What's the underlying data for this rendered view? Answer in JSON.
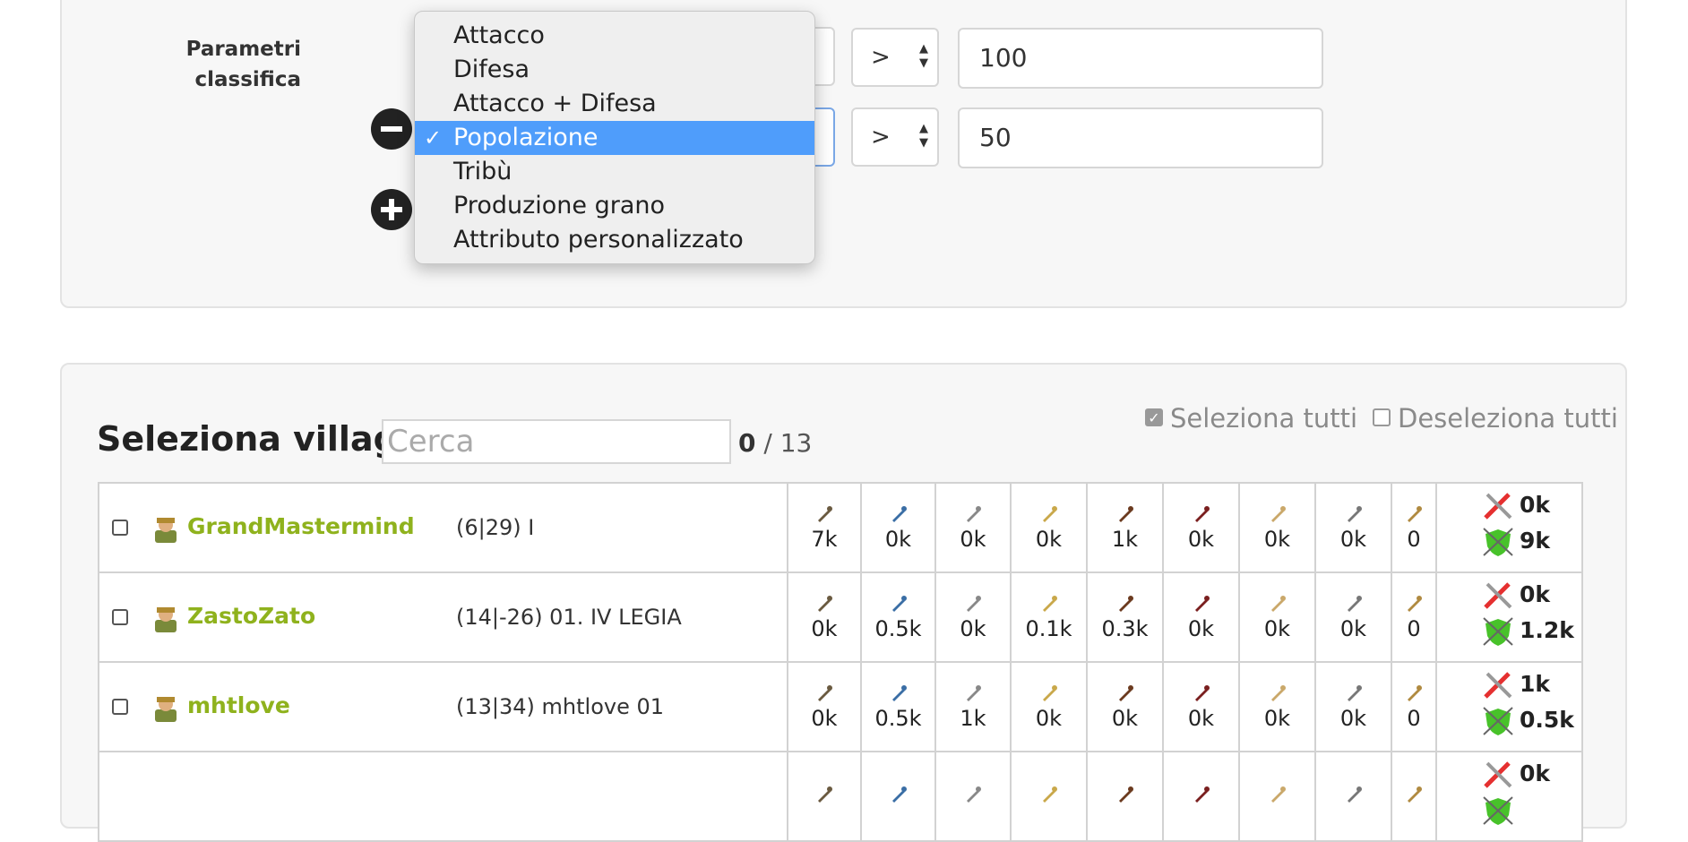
{
  "params": {
    "label_line1": "Parametri",
    "label_line2": "classifica",
    "rows": [
      {
        "operator": ">",
        "value": "100"
      },
      {
        "operator": ">",
        "value": "50"
      }
    ]
  },
  "dropdown": {
    "options": [
      "Attacco",
      "Difesa",
      "Attacco + Difesa",
      "Popolazione",
      "Tribù",
      "Produzione grano",
      "Attributo personalizzato"
    ],
    "selected": "Popolazione",
    "check_mark": "✓"
  },
  "villages": {
    "title": "Seleziona villaggi",
    "search_placeholder": "Cerca",
    "selected_count": "0",
    "total_label": "/ 13",
    "select_all_label": "Seleziona tutti",
    "deselect_all_label": "Deseleziona tutti",
    "rows": [
      {
        "player": "GrandMastermind",
        "village": "(6|29) I",
        "units": [
          "7k",
          "0k",
          "0k",
          "0k",
          "1k",
          "0k",
          "0k",
          "0k",
          "0"
        ],
        "attack": "0k",
        "defense": "9k"
      },
      {
        "player": "ZastoZato",
        "village": "(14|-26) 01. IV LEGIA",
        "units": [
          "0k",
          "0.5k",
          "0k",
          "0.1k",
          "0.3k",
          "0k",
          "0k",
          "0k",
          "0"
        ],
        "attack": "0k",
        "defense": "1.2k"
      },
      {
        "player": "mhtlove",
        "village": "(13|34) mhtlove 01",
        "units": [
          "0k",
          "0.5k",
          "1k",
          "0k",
          "0k",
          "0k",
          "0k",
          "0k",
          "0"
        ],
        "attack": "1k",
        "defense": "0.5k"
      },
      {
        "player": "",
        "village": "",
        "units": [
          "",
          "",
          "",
          "",
          "",
          "",
          "",
          "",
          ""
        ],
        "attack": "0k",
        "defense": ""
      }
    ]
  },
  "colors": {
    "player_name": "#8fb21d",
    "selected_option": "#4f9dfb",
    "attack_swords": "#e53030",
    "defense_shield": "#48c22a"
  },
  "icons": {
    "remove": "minus-circle-icon",
    "add": "plus-circle-icon",
    "attack": "crossed-swords-icon",
    "defense": "shield-icon"
  }
}
